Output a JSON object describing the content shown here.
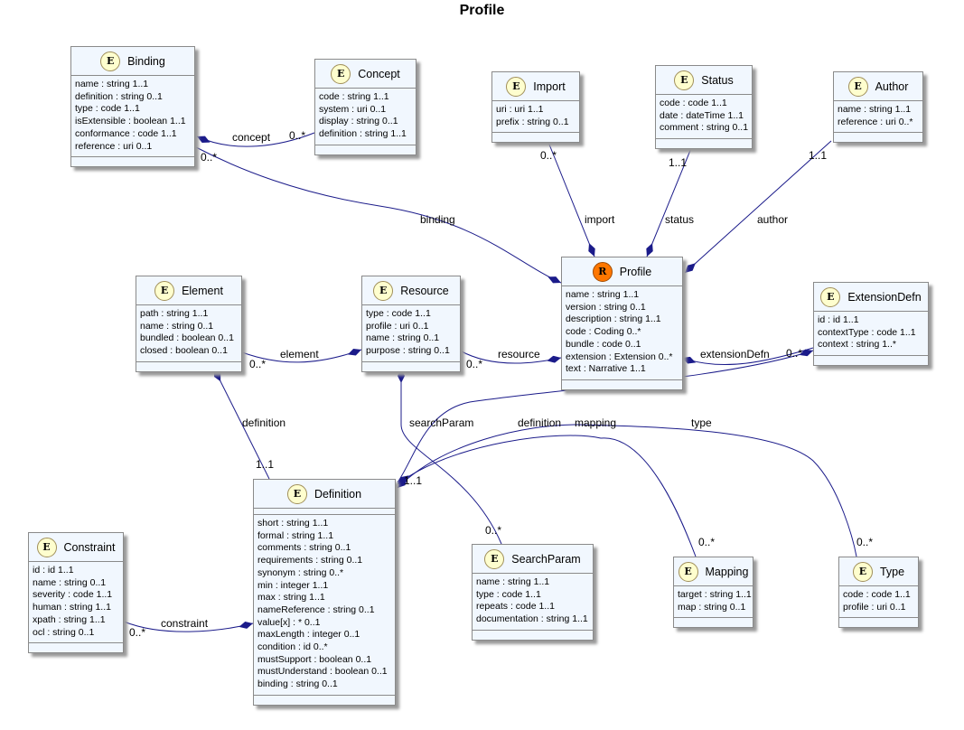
{
  "title": "Profile",
  "colors": {
    "edge": "#1b1b8a",
    "box_fill": "#F1F7FE",
    "entity_badge": "#FEFECE",
    "resource_badge": "#FF7700"
  },
  "classes": [
    {
      "id": "binding",
      "name": "Binding",
      "stereotype": "E",
      "attributes": [
        "name : string 1..1",
        "definition : string 0..1",
        "type : code 1..1",
        "isExtensible : boolean 1..1",
        "conformance : code 1..1",
        "reference : uri 0..1"
      ]
    },
    {
      "id": "concept",
      "name": "Concept",
      "stereotype": "E",
      "attributes": [
        "code : string 1..1",
        "system : uri 0..1",
        "display : string 0..1",
        "definition : string 1..1"
      ]
    },
    {
      "id": "import",
      "name": "Import",
      "stereotype": "E",
      "attributes": [
        "uri : uri 1..1",
        "prefix : string 0..1"
      ]
    },
    {
      "id": "status",
      "name": "Status",
      "stereotype": "E",
      "attributes": [
        "code : code 1..1",
        "date : dateTime 1..1",
        "comment : string 0..1"
      ]
    },
    {
      "id": "author",
      "name": "Author",
      "stereotype": "E",
      "attributes": [
        "name : string 1..1",
        "reference : uri 0..*"
      ]
    },
    {
      "id": "element",
      "name": "Element",
      "stereotype": "E",
      "attributes": [
        "path : string 1..1",
        "name : string 0..1",
        "bundled : boolean 0..1",
        "closed : boolean 0..1"
      ]
    },
    {
      "id": "resource",
      "name": "Resource",
      "stereotype": "E",
      "attributes": [
        "type : code 1..1",
        "profile : uri 0..1",
        "name : string 0..1",
        "purpose : string 0..1"
      ]
    },
    {
      "id": "profile",
      "name": "Profile",
      "stereotype": "R",
      "attributes": [
        "name : string 1..1",
        "version : string 0..1",
        "description : string 1..1",
        "code : Coding 0..*",
        "bundle : code 0..1",
        "extension : Extension 0..*",
        "text : Narrative 1..1"
      ]
    },
    {
      "id": "extensiondefn",
      "name": "ExtensionDefn",
      "stereotype": "E",
      "attributes": [
        "id : id 1..1",
        "contextType : code 1..1",
        "context : string 1..*"
      ]
    },
    {
      "id": "definition",
      "name": "Definition",
      "stereotype": "E",
      "empty_first": true,
      "attributes": [
        "short : string 1..1",
        "formal : string 1..1",
        "comments : string 0..1",
        "requirements : string 0..1",
        "synonym : string 0..*",
        "min : integer 1..1",
        "max : string 1..1",
        "nameReference : string 0..1",
        "value[x] : * 0..1",
        "maxLength : integer 0..1",
        "condition : id 0..*",
        "mustSupport : boolean 0..1",
        "mustUnderstand : boolean 0..1",
        "binding : string 0..1"
      ]
    },
    {
      "id": "constraint",
      "name": "Constraint",
      "stereotype": "E",
      "attributes": [
        "id : id 1..1",
        "name : string 0..1",
        "severity : code 1..1",
        "human : string 1..1",
        "xpath : string 1..1",
        "ocl : string 0..1"
      ]
    },
    {
      "id": "searchparam",
      "name": "SearchParam",
      "stereotype": "E",
      "attributes": [
        "name : string 1..1",
        "type : code 1..1",
        "repeats : code 1..1",
        "documentation : string 1..1"
      ]
    },
    {
      "id": "mapping",
      "name": "Mapping",
      "stereotype": "E",
      "attributes": [
        "target : string 1..1",
        "map : string 0..1"
      ]
    },
    {
      "id": "type",
      "name": "Type",
      "stereotype": "E",
      "attributes": [
        "code : code 1..1",
        "profile : uri 0..1"
      ]
    }
  ],
  "edges": [
    {
      "id": "concept",
      "from": "Binding",
      "to": "Concept",
      "label": "concept",
      "multiplicity": "0..*"
    },
    {
      "id": "binding",
      "from": "Profile",
      "to": "Binding",
      "label": "binding",
      "multiplicity": "0..*"
    },
    {
      "id": "import",
      "from": "Profile",
      "to": "Import",
      "label": "import",
      "multiplicity": "0..*"
    },
    {
      "id": "status",
      "from": "Profile",
      "to": "Status",
      "label": "status",
      "multiplicity": "1..1"
    },
    {
      "id": "author",
      "from": "Profile",
      "to": "Author",
      "label": "author",
      "multiplicity": "1..1"
    },
    {
      "id": "element",
      "from": "Resource",
      "to": "Element",
      "label": "element",
      "multiplicity": "0..*"
    },
    {
      "id": "resource",
      "from": "Profile",
      "to": "Resource",
      "label": "resource",
      "multiplicity": "0..*"
    },
    {
      "id": "extensionDefn",
      "from": "Profile",
      "to": "ExtensionDefn",
      "label": "extensionDefn",
      "multiplicity": "0..*"
    },
    {
      "id": "elemdef",
      "from": "Element",
      "to": "Definition",
      "label": "definition",
      "multiplicity": "1..1"
    },
    {
      "id": "searchParam",
      "from": "Resource",
      "to": "SearchParam",
      "label": "searchParam",
      "multiplicity": "0..*"
    },
    {
      "id": "extdef",
      "from": "ExtensionDefn",
      "to": "Definition",
      "label": "definition",
      "multiplicity": "1..1"
    },
    {
      "id": "mapping",
      "from": "Definition",
      "to": "Mapping",
      "label": "mapping",
      "multiplicity": "0..*"
    },
    {
      "id": "type",
      "from": "Definition",
      "to": "Type",
      "label": "type",
      "multiplicity": "0..*"
    },
    {
      "id": "constraint",
      "from": "Definition",
      "to": "Constraint",
      "label": "constraint",
      "multiplicity": "0..*"
    }
  ]
}
